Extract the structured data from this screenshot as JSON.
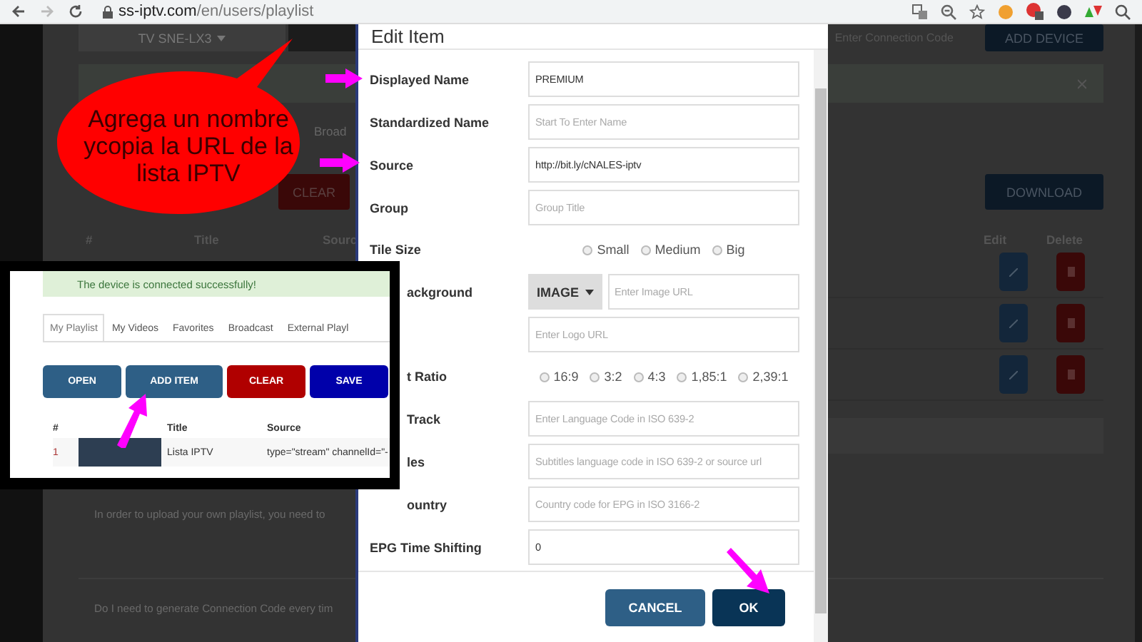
{
  "browser": {
    "url_host": "ss-iptv.com",
    "url_path": "/en/users/playlist"
  },
  "page": {
    "device_select": "TV SNE-LX3",
    "connection_code_placeholder": "Enter Connection Code",
    "add_device": "ADD DEVICE",
    "tab_fragment": "Broad",
    "clear": "CLEAR",
    "download": "DOWNLOAD",
    "columns": [
      "#",
      "Title",
      "Sourc",
      "Edit",
      "Delete"
    ],
    "rows": [
      {
        "kind": "item"
      },
      {
        "kind": "item"
      },
      {
        "kind": "item"
      }
    ],
    "faq": [
      "In order to upload your own playlist, you need to",
      "Do I need to generate Connection Code every tim"
    ]
  },
  "modal": {
    "title": "Edit Item",
    "fields": [
      {
        "kind": "text",
        "label": "Displayed Name",
        "value": "PREMIUM"
      },
      {
        "kind": "text",
        "label": "Standardized Name",
        "placeholder": "Start To Enter Name"
      },
      {
        "kind": "text",
        "label": "Source",
        "value": "http://bit.ly/cNALES-iptv"
      },
      {
        "kind": "text",
        "label": "Group",
        "placeholder": "Group Title"
      },
      {
        "kind": "radios",
        "label": "Tile Size",
        "options": [
          {
            "label": "Small",
            "selected": false
          },
          {
            "label": "Medium",
            "selected": false
          },
          {
            "label": "Big",
            "selected": false
          }
        ]
      },
      {
        "kind": "image",
        "label": "ackground",
        "button": "IMAGE",
        "placeholder": "Enter Image URL"
      },
      {
        "kind": "text",
        "placeholder": "Enter Logo URL"
      },
      {
        "kind": "radios",
        "label": "t Ratio",
        "options": [
          {
            "label": "16:9",
            "selected": false
          },
          {
            "label": "3:2",
            "selected": false
          },
          {
            "label": "4:3",
            "selected": false
          },
          {
            "label": "1,85:1",
            "selected": false
          },
          {
            "label": "2,39:1",
            "selected": false
          }
        ]
      },
      {
        "kind": "text",
        "label": "Track",
        "placeholder": "Enter Language Code in ISO 639-2"
      },
      {
        "kind": "text",
        "label": "les",
        "placeholder": "Subtitles language code in ISO 639-2 or source url"
      },
      {
        "kind": "text",
        "label": "ountry",
        "placeholder": "Country code for EPG in ISO 3166-2"
      },
      {
        "kind": "text",
        "label": "EPG Time Shifting",
        "value": "0"
      }
    ],
    "buttons": [
      {
        "label": "CANCEL",
        "kind": "secondary"
      },
      {
        "label": "OK",
        "kind": "primary"
      }
    ]
  },
  "inset": {
    "alert": "The device is connected successfully!",
    "tabs": [
      {
        "label": "My Playlist",
        "selected": true
      },
      {
        "label": "My Videos",
        "selected": false
      },
      {
        "label": "Favorites",
        "selected": false
      },
      {
        "label": "Broadcast",
        "selected": false
      },
      {
        "label": "External Playl",
        "selected": false
      }
    ],
    "buttons": [
      {
        "label": "OPEN",
        "color": "#2e5f86"
      },
      {
        "label": "ADD ITEM",
        "color": "#2e5f86"
      },
      {
        "label": "CLEAR",
        "color": "#b00000"
      },
      {
        "label": "SAVE",
        "color": "#0000aa"
      }
    ],
    "columns": [
      "#",
      "Title",
      "Source"
    ],
    "rows": [
      {
        "index": "1",
        "title": "Lista IPTV",
        "source": "type=\"stream\" channelId=\"-"
      }
    ]
  },
  "callout": {
    "lines": [
      "Agrega un nombre",
      "ycopia la URL de la",
      "lista IPTV"
    ]
  }
}
